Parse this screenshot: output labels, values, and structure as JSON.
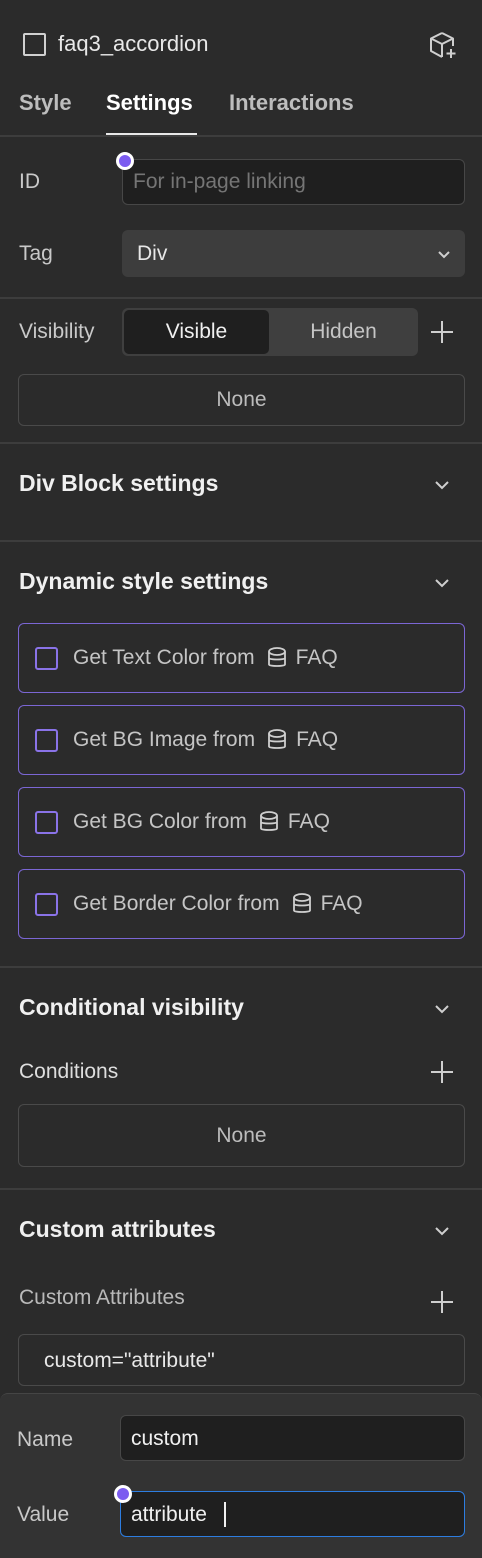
{
  "header": {
    "element_name": "faq3_accordion",
    "component_icon": "box-plus-icon"
  },
  "tabs": [
    {
      "label": "Style",
      "active": false
    },
    {
      "label": "Settings",
      "active": true
    },
    {
      "label": "Interactions",
      "active": false
    }
  ],
  "id_field": {
    "label": "ID",
    "placeholder": "For in-page linking",
    "value": ""
  },
  "tag_field": {
    "label": "Tag",
    "value": "Div"
  },
  "visibility": {
    "label": "Visibility",
    "options": [
      "Visible",
      "Hidden"
    ],
    "selected": "Visible",
    "summary": "None"
  },
  "div_block": {
    "title": "Div Block settings"
  },
  "dynamic_style": {
    "title": "Dynamic style settings",
    "items": [
      {
        "label": "Get Text Color from",
        "source": "FAQ"
      },
      {
        "label": "Get BG Image from",
        "source": "FAQ"
      },
      {
        "label": "Get BG Color from",
        "source": "FAQ"
      },
      {
        "label": "Get Border Color from",
        "source": "FAQ"
      }
    ]
  },
  "conditional_visibility": {
    "title": "Conditional visibility",
    "conditions_label": "Conditions",
    "conditions_value": "None"
  },
  "custom_attributes": {
    "title": "Custom attributes",
    "list_label": "Custom Attributes",
    "items": [
      "custom=\"attribute\""
    ]
  },
  "attribute_editor": {
    "name_label": "Name",
    "name_value": "custom",
    "value_label": "Value",
    "value_value": "attribute"
  },
  "colors": {
    "accent": "#7c5cf0",
    "focus": "#2d7de0",
    "panel": "#2b2b2b"
  }
}
